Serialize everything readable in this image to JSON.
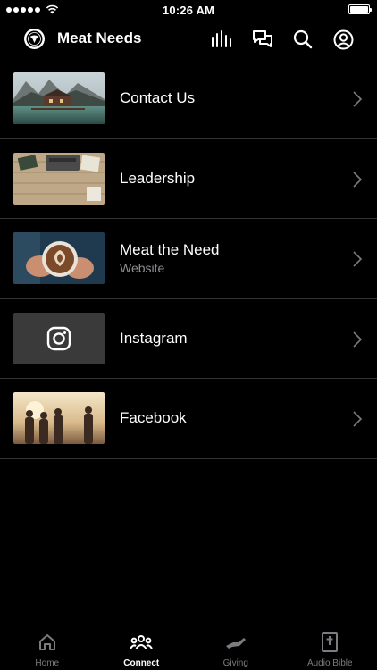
{
  "status_bar": {
    "time": "10:26 AM"
  },
  "header": {
    "title": "Meat Needs",
    "icons": [
      "audio-bars-icon",
      "chat-icon",
      "search-icon",
      "profile-icon"
    ]
  },
  "list": {
    "items": [
      {
        "title": "Contact Us",
        "subtitle": "",
        "thumb": "lake-house-photo"
      },
      {
        "title": "Leadership",
        "subtitle": "",
        "thumb": "desk-typewriter-photo"
      },
      {
        "title": "Meat the Need",
        "subtitle": "Website",
        "thumb": "coffee-latte-photo"
      },
      {
        "title": "Instagram",
        "subtitle": "",
        "thumb": "instagram-logo"
      },
      {
        "title": "Facebook",
        "subtitle": "",
        "thumb": "group-sunset-photo"
      }
    ]
  },
  "tabs": [
    {
      "label": "Home",
      "icon": "home-icon",
      "active": false
    },
    {
      "label": "Connect",
      "icon": "people-icon",
      "active": true
    },
    {
      "label": "Giving",
      "icon": "giving-hand-icon",
      "active": false
    },
    {
      "label": "Audio Bible",
      "icon": "bible-icon",
      "active": false
    }
  ],
  "colors": {
    "background": "#000000",
    "divider": "#333333",
    "subtitle": "#8e8e93",
    "tab_inactive": "#7c7c80"
  }
}
